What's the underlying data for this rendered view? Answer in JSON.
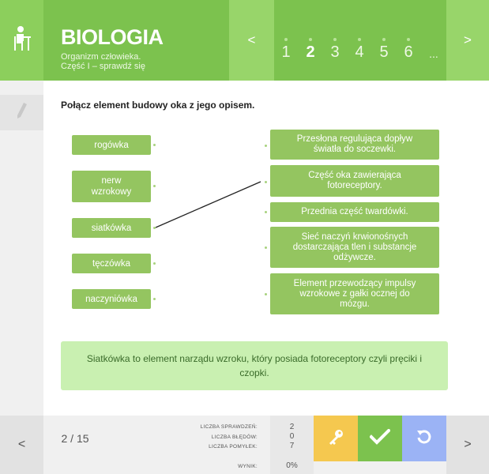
{
  "header": {
    "subject": "BIOLOGIA",
    "subtitle_line1": "Organizm człowieka.",
    "subtitle_line2": "Część I – sprawdź się",
    "prev_label": "<",
    "next_label": ">",
    "pages": [
      "1",
      "2",
      "3",
      "4",
      "5",
      "6",
      "..."
    ],
    "current_page": "2"
  },
  "task": {
    "question": "Połącz element budowy oka z jego opisem.",
    "left_items": [
      "rogówka",
      "nerw\nwzrokowy",
      "siatkówka",
      "tęczówka",
      "naczyniówka"
    ],
    "right_items": [
      "Przesłona regulująca dopływ światła do soczewki.",
      "Część oka zawierająca fotoreceptory.",
      "Przednia część twardówki.",
      "Sieć naczyń krwionośnych dostarczająca tlen i substancje odżywcze.",
      "Element przewodzący impulsy wzrokowe z gałki ocznej do mózgu."
    ],
    "connection": {
      "from": "siatkówka",
      "to": "Część oka zawierająca fotoreceptory."
    },
    "feedback": "Siatkówka to element narządu wzroku, który posiada fotoreceptory czyli pręciki i czopki."
  },
  "footer": {
    "prev_label": "<",
    "next_label": ">",
    "counter": "2 / 15",
    "stats": [
      {
        "label": "LICZBA SPRAWDZEŃ:",
        "value": "2"
      },
      {
        "label": "LICZBA BŁĘDÓW:",
        "value": "0"
      },
      {
        "label": "LICZBA POMYŁEK:",
        "value": "7"
      },
      {
        "label": "WYNIK:",
        "value": "0%"
      }
    ]
  },
  "icons": {
    "header": "student-at-desk-icon",
    "sidebar": "pencil-icon",
    "key": "key-icon",
    "check": "checkmark-icon",
    "reset": "reset-icon"
  },
  "colors": {
    "green": "#7cc24e",
    "light_green": "#98d56a",
    "box_green": "#94c560",
    "feedback_bg": "#c9f0b1",
    "key_yellow": "#f5c84f",
    "reset_blue": "#9bb3f5"
  }
}
